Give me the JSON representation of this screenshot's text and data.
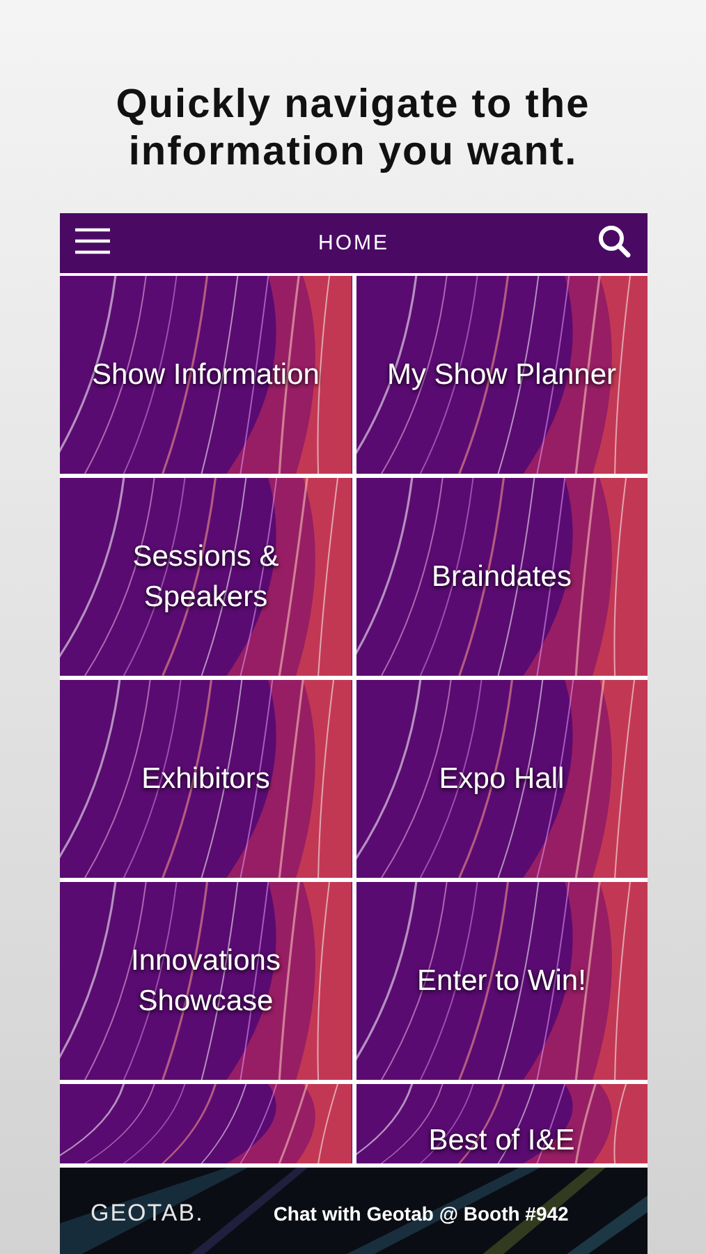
{
  "heading": "Quickly navigate to the information you want.",
  "header": {
    "title": "HOME"
  },
  "tiles": [
    {
      "kind": "labeled",
      "label": "Show Information"
    },
    {
      "kind": "labeled",
      "label": "My Show Planner"
    },
    {
      "kind": "labeled",
      "label": "Sessions & Speakers"
    },
    {
      "kind": "labeled",
      "label": "Braindates"
    },
    {
      "kind": "labeled",
      "label": "Exhibitors"
    },
    {
      "kind": "labeled",
      "label": "Expo Hall"
    },
    {
      "kind": "labeled",
      "label": "Innovations Showcase"
    },
    {
      "kind": "labeled",
      "label": "Enter to Win!"
    },
    {
      "kind": "blank"
    },
    {
      "kind": "labeled",
      "label": "Best of I&E"
    }
  ],
  "banner": {
    "logo": "GEOTAB.",
    "message": "Chat with Geotab @ Booth #942"
  }
}
